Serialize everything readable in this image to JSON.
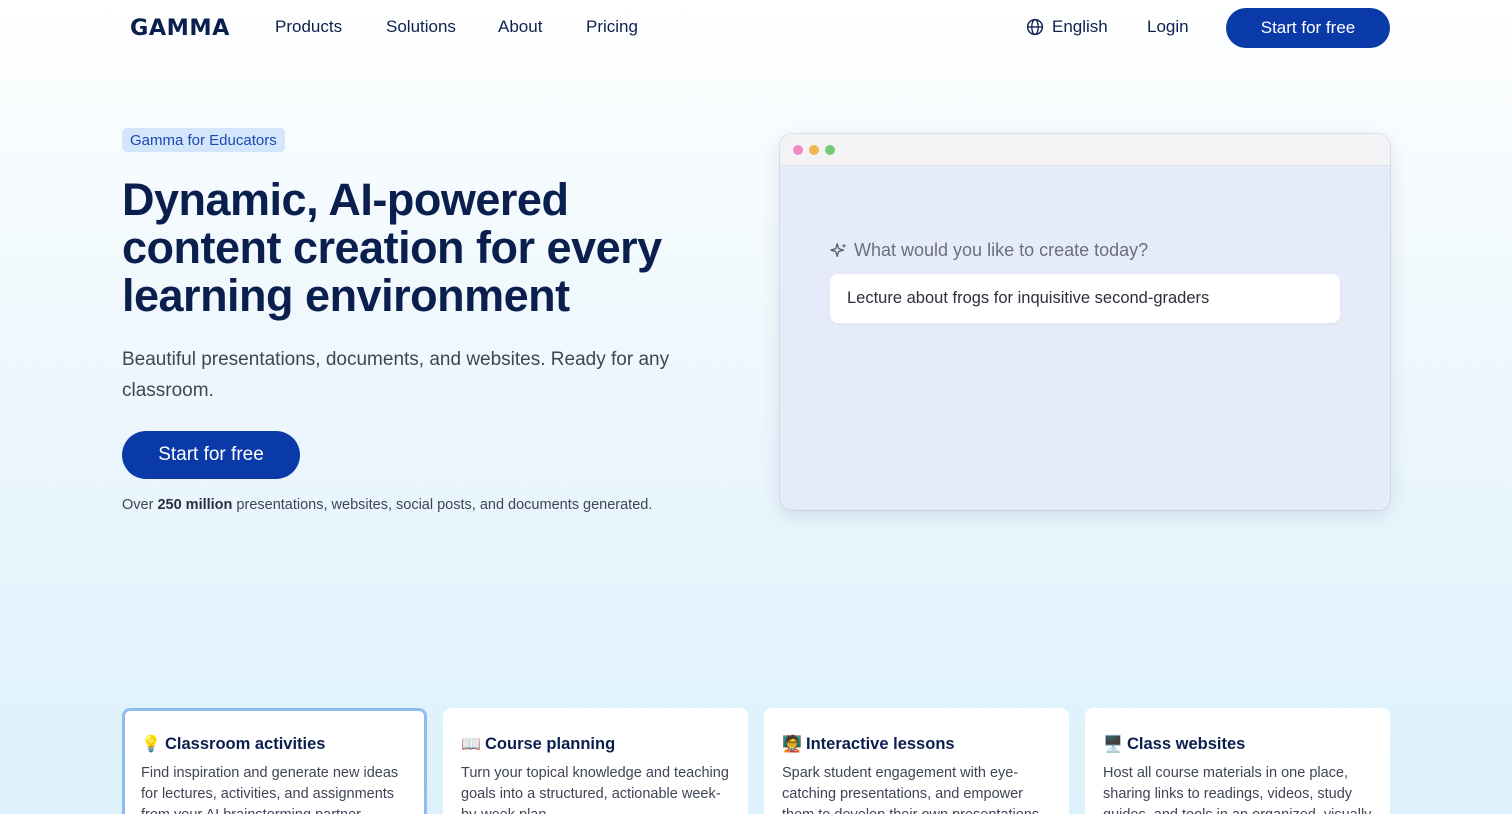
{
  "nav": {
    "logo_text": "GAMMA",
    "links": [
      "Products",
      "Solutions",
      "About",
      "Pricing"
    ],
    "language": "English",
    "login": "Login",
    "cta": "Start for free"
  },
  "hero": {
    "badge": "Gamma for Educators",
    "title": "Dynamic, AI-powered content creation for every learning environment",
    "subtitle": "Beautiful presentations, documents, and websites. Ready for any classroom.",
    "cta": "Start for free",
    "stat_prefix": "Over ",
    "stat_bold": "250 million",
    "stat_suffix": " presentations, websites, social posts, and documents generated."
  },
  "mock": {
    "prompt_label": "What would you like to create today?",
    "prompt_value": "Lecture about frogs for inquisitive second-graders"
  },
  "cards": [
    {
      "emoji": "💡",
      "title": "Classroom activities",
      "desc": "Find inspiration and generate new ideas for lectures, activities, and assignments from your AI brainstorming partner."
    },
    {
      "emoji": "📖",
      "title": "Course planning",
      "desc": "Turn your topical knowledge and teaching goals into a structured, actionable week-by-week plan."
    },
    {
      "emoji": "🧑‍🏫",
      "title": "Interactive lessons",
      "desc": "Spark student engagement with eye-catching presentations, and empower them to develop their own presentations."
    },
    {
      "emoji": "🖥️",
      "title": "Class websites",
      "desc": "Host all course materials in one place, sharing links to readings, videos, study guides, and tools in an organized, visually engaging site."
    }
  ],
  "colors": {
    "primary": "#0a3aa8",
    "heading": "#0b1f4e",
    "badge_bg": "#d4e6fb",
    "active_card_border": "#8fbcf0"
  }
}
